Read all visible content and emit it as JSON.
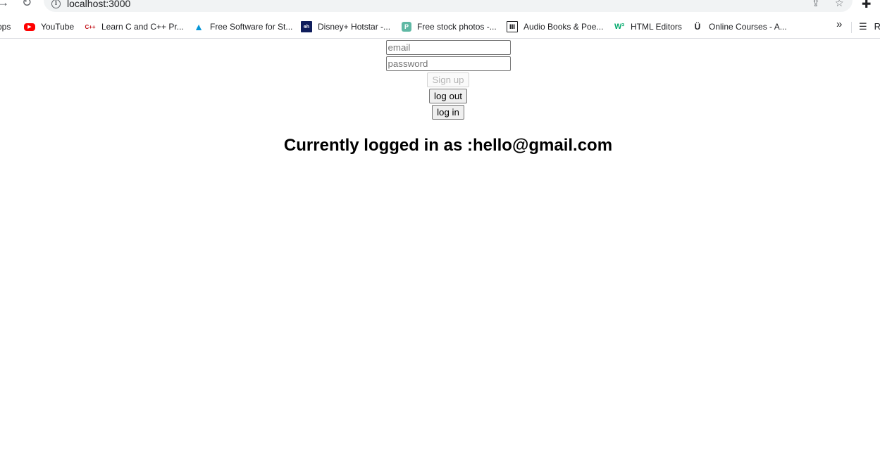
{
  "browser": {
    "url": "localhost:3000",
    "bookmarks": [
      {
        "label": "pps",
        "icon": "apps-grid-icon"
      },
      {
        "label": "YouTube",
        "icon": "youtube-icon",
        "color": "#ff0000"
      },
      {
        "label": "Learn C and C++ Pr...",
        "icon": "cpp-icon",
        "color": "#c4161c"
      },
      {
        "label": "Free Software for St...",
        "icon": "autodesk-icon",
        "color": "#0696d7"
      },
      {
        "label": "Disney+ Hotstar -...",
        "icon": "hotstar-icon",
        "color": "#0f1d5c"
      },
      {
        "label": "Free stock photos -...",
        "icon": "pexels-icon",
        "color": "#5fb8a4"
      },
      {
        "label": "Audio Books & Poe...",
        "icon": "library-icon",
        "color": "#202124"
      },
      {
        "label": "HTML Editors",
        "icon": "w3-icon",
        "color": "#04aa6d"
      },
      {
        "label": "Online Courses - A...",
        "icon": "udemy-icon",
        "color": "#202124"
      }
    ],
    "reading_list_label": "R"
  },
  "form": {
    "email_placeholder": "email",
    "password_placeholder": "password",
    "signup_label": "Sign up",
    "logout_label": "log out",
    "login_label": "log in"
  },
  "status": {
    "heading": "Currently logged in as :hello@gmail.com"
  }
}
